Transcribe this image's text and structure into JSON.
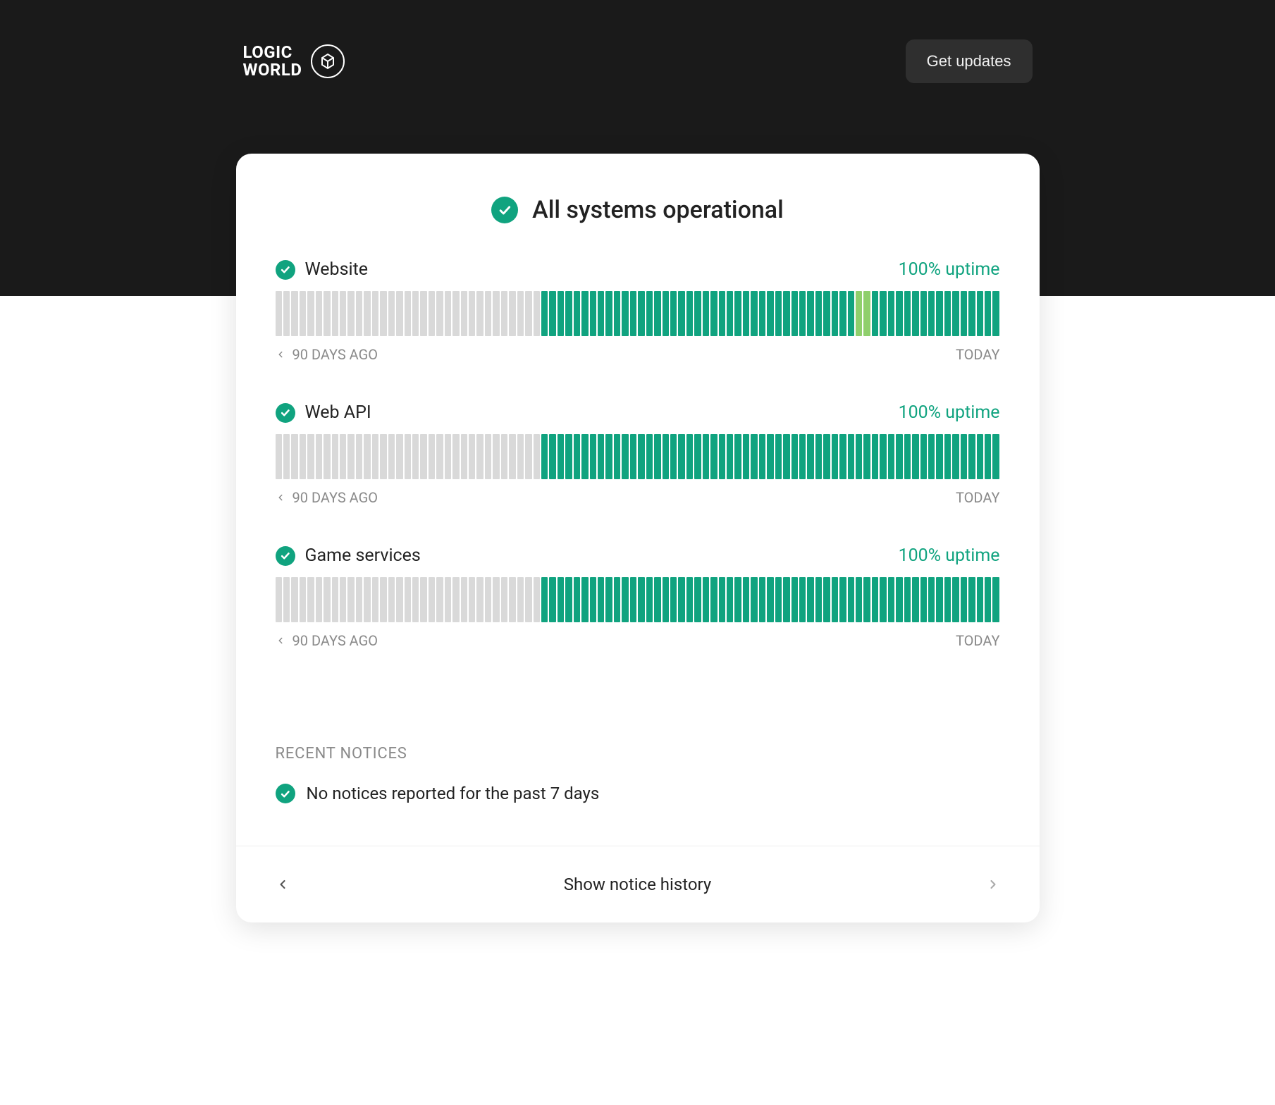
{
  "brand": {
    "line1": "LOGIC",
    "line2": "WORLD"
  },
  "header": {
    "get_updates": "Get updates"
  },
  "status": {
    "headline": "All systems operational"
  },
  "timeline": {
    "past_label": "90 DAYS AGO",
    "today_label": "TODAY",
    "total_days": 90
  },
  "services": [
    {
      "name": "Website",
      "uptime": "100% uptime",
      "nodata_days": 33,
      "partial_indices": [
        72,
        73
      ]
    },
    {
      "name": "Web API",
      "uptime": "100% uptime",
      "nodata_days": 33,
      "partial_indices": []
    },
    {
      "name": "Game services",
      "uptime": "100% uptime",
      "nodata_days": 33,
      "partial_indices": []
    }
  ],
  "notices": {
    "section_title": "RECENT NOTICES",
    "empty_message": "No notices reported for the past 7 days"
  },
  "footer": {
    "history_label": "Show notice history"
  },
  "colors": {
    "accent": "#10a37f",
    "nodata": "#d9d9d9",
    "partial": "#8fcf6c",
    "header_bg": "#1a1a1a"
  }
}
